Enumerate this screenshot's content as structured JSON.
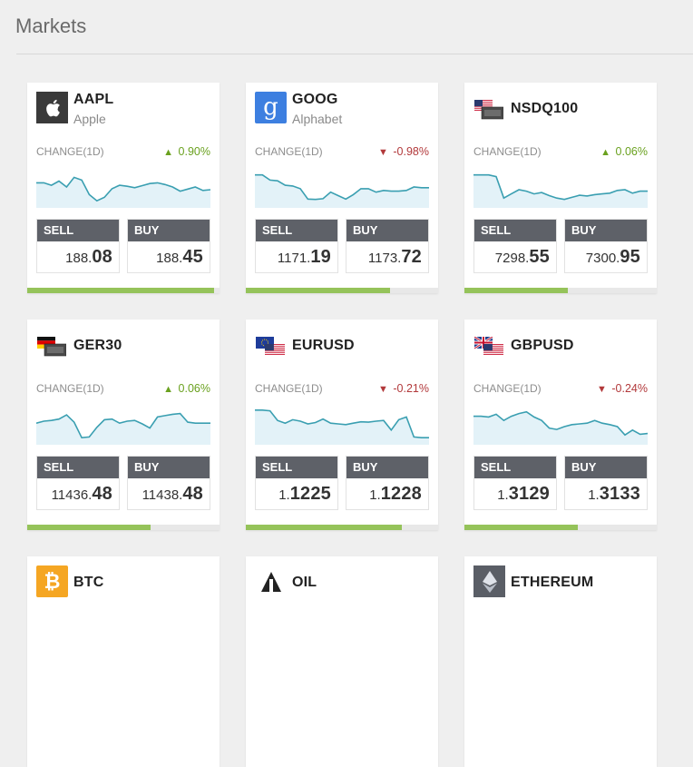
{
  "page": {
    "title": "Markets"
  },
  "labels": {
    "change": "CHANGE(1D)",
    "sell": "SELL",
    "buy": "BUY"
  },
  "colors": {
    "up": "#6aa11f",
    "down": "#b2393b",
    "bar": "#95c35a",
    "spark_line": "#3a9fb1",
    "spark_fill": "#e3f2f8",
    "header": "#5e6168"
  },
  "cards": [
    {
      "symbol": "AAPL",
      "name": "Apple",
      "icon": "apple-icon",
      "direction": "up",
      "change": "0.90%",
      "sell_main": "188.",
      "sell_big": "08",
      "buy_main": "188.",
      "buy_big": "45",
      "sentiment": 0.97,
      "spark": [
        0.38,
        0.38,
        0.45,
        0.33,
        0.5,
        0.22,
        0.3,
        0.72,
        0.9,
        0.8,
        0.55,
        0.45,
        0.48,
        0.52,
        0.46,
        0.4,
        0.38,
        0.43,
        0.5,
        0.62,
        0.56,
        0.5,
        0.6,
        0.58
      ]
    },
    {
      "symbol": "GOOG",
      "name": "Alphabet",
      "icon": "google-icon",
      "direction": "down",
      "change": "-0.98%",
      "sell_main": "1171.",
      "sell_big": "19",
      "buy_main": "1173.",
      "buy_big": "72",
      "sentiment": 0.75,
      "spark": [
        0.15,
        0.15,
        0.3,
        0.32,
        0.45,
        0.47,
        0.55,
        0.85,
        0.86,
        0.84,
        0.65,
        0.75,
        0.85,
        0.72,
        0.55,
        0.55,
        0.65,
        0.6,
        0.62,
        0.62,
        0.6,
        0.5,
        0.52,
        0.52
      ]
    },
    {
      "symbol": "NSDQ100",
      "name": "",
      "icon": "us-flag-icon",
      "direction": "up",
      "change": "0.06%",
      "sell_main": "7298.",
      "sell_big": "55",
      "buy_main": "7300.",
      "buy_big": "95",
      "sentiment": 0.54,
      "spark": [
        0.15,
        0.15,
        0.15,
        0.2,
        0.82,
        0.7,
        0.58,
        0.62,
        0.7,
        0.66,
        0.75,
        0.82,
        0.86,
        0.8,
        0.74,
        0.76,
        0.72,
        0.7,
        0.68,
        0.6,
        0.58,
        0.68,
        0.62,
        0.62
      ]
    },
    {
      "symbol": "GER30",
      "name": "",
      "icon": "germany-flag-icon",
      "direction": "up",
      "change": "0.06%",
      "sell_main": "11436.",
      "sell_big": "48",
      "buy_main": "11438.",
      "buy_big": "48",
      "sentiment": 0.64,
      "spark": [
        0.48,
        0.42,
        0.4,
        0.36,
        0.24,
        0.45,
        0.9,
        0.88,
        0.6,
        0.38,
        0.36,
        0.48,
        0.42,
        0.4,
        0.5,
        0.62,
        0.3,
        0.26,
        0.22,
        0.2,
        0.45,
        0.48,
        0.48,
        0.48
      ]
    },
    {
      "symbol": "EURUSD",
      "name": "",
      "icon": "eu-us-flag-icon",
      "direction": "down",
      "change": "-0.21%",
      "sell_main": "1.",
      "sell_big": "1225",
      "buy_main": "1.",
      "buy_big": "1228",
      "sentiment": 0.81,
      "spark": [
        0.1,
        0.1,
        0.12,
        0.4,
        0.48,
        0.38,
        0.42,
        0.5,
        0.46,
        0.36,
        0.48,
        0.5,
        0.52,
        0.48,
        0.44,
        0.45,
        0.42,
        0.4,
        0.68,
        0.38,
        0.3,
        0.88,
        0.9,
        0.9
      ]
    },
    {
      "symbol": "GBPUSD",
      "name": "",
      "icon": "uk-us-flag-icon",
      "direction": "down",
      "change": "-0.24%",
      "sell_main": "1.",
      "sell_big": "3129",
      "buy_main": "1.",
      "buy_big": "3133",
      "sentiment": 0.59,
      "spark": [
        0.28,
        0.28,
        0.3,
        0.22,
        0.4,
        0.28,
        0.2,
        0.15,
        0.3,
        0.4,
        0.62,
        0.66,
        0.58,
        0.52,
        0.5,
        0.48,
        0.4,
        0.48,
        0.52,
        0.58,
        0.82,
        0.68,
        0.8,
        0.78
      ]
    },
    {
      "symbol": "BTC",
      "name": "",
      "icon": "bitcoin-icon",
      "direction": "",
      "change": "",
      "sell_main": "",
      "sell_big": "",
      "buy_main": "",
      "buy_big": "",
      "sentiment": 0,
      "spark": []
    },
    {
      "symbol": "OIL",
      "name": "",
      "icon": "oil-icon",
      "direction": "",
      "change": "",
      "sell_main": "",
      "sell_big": "",
      "buy_main": "",
      "buy_big": "",
      "sentiment": 0,
      "spark": []
    },
    {
      "symbol": "ETHEREUM",
      "name": "",
      "icon": "ethereum-icon",
      "direction": "",
      "change": "",
      "sell_main": "",
      "sell_big": "",
      "buy_main": "",
      "buy_big": "",
      "sentiment": 0,
      "spark": []
    }
  ]
}
